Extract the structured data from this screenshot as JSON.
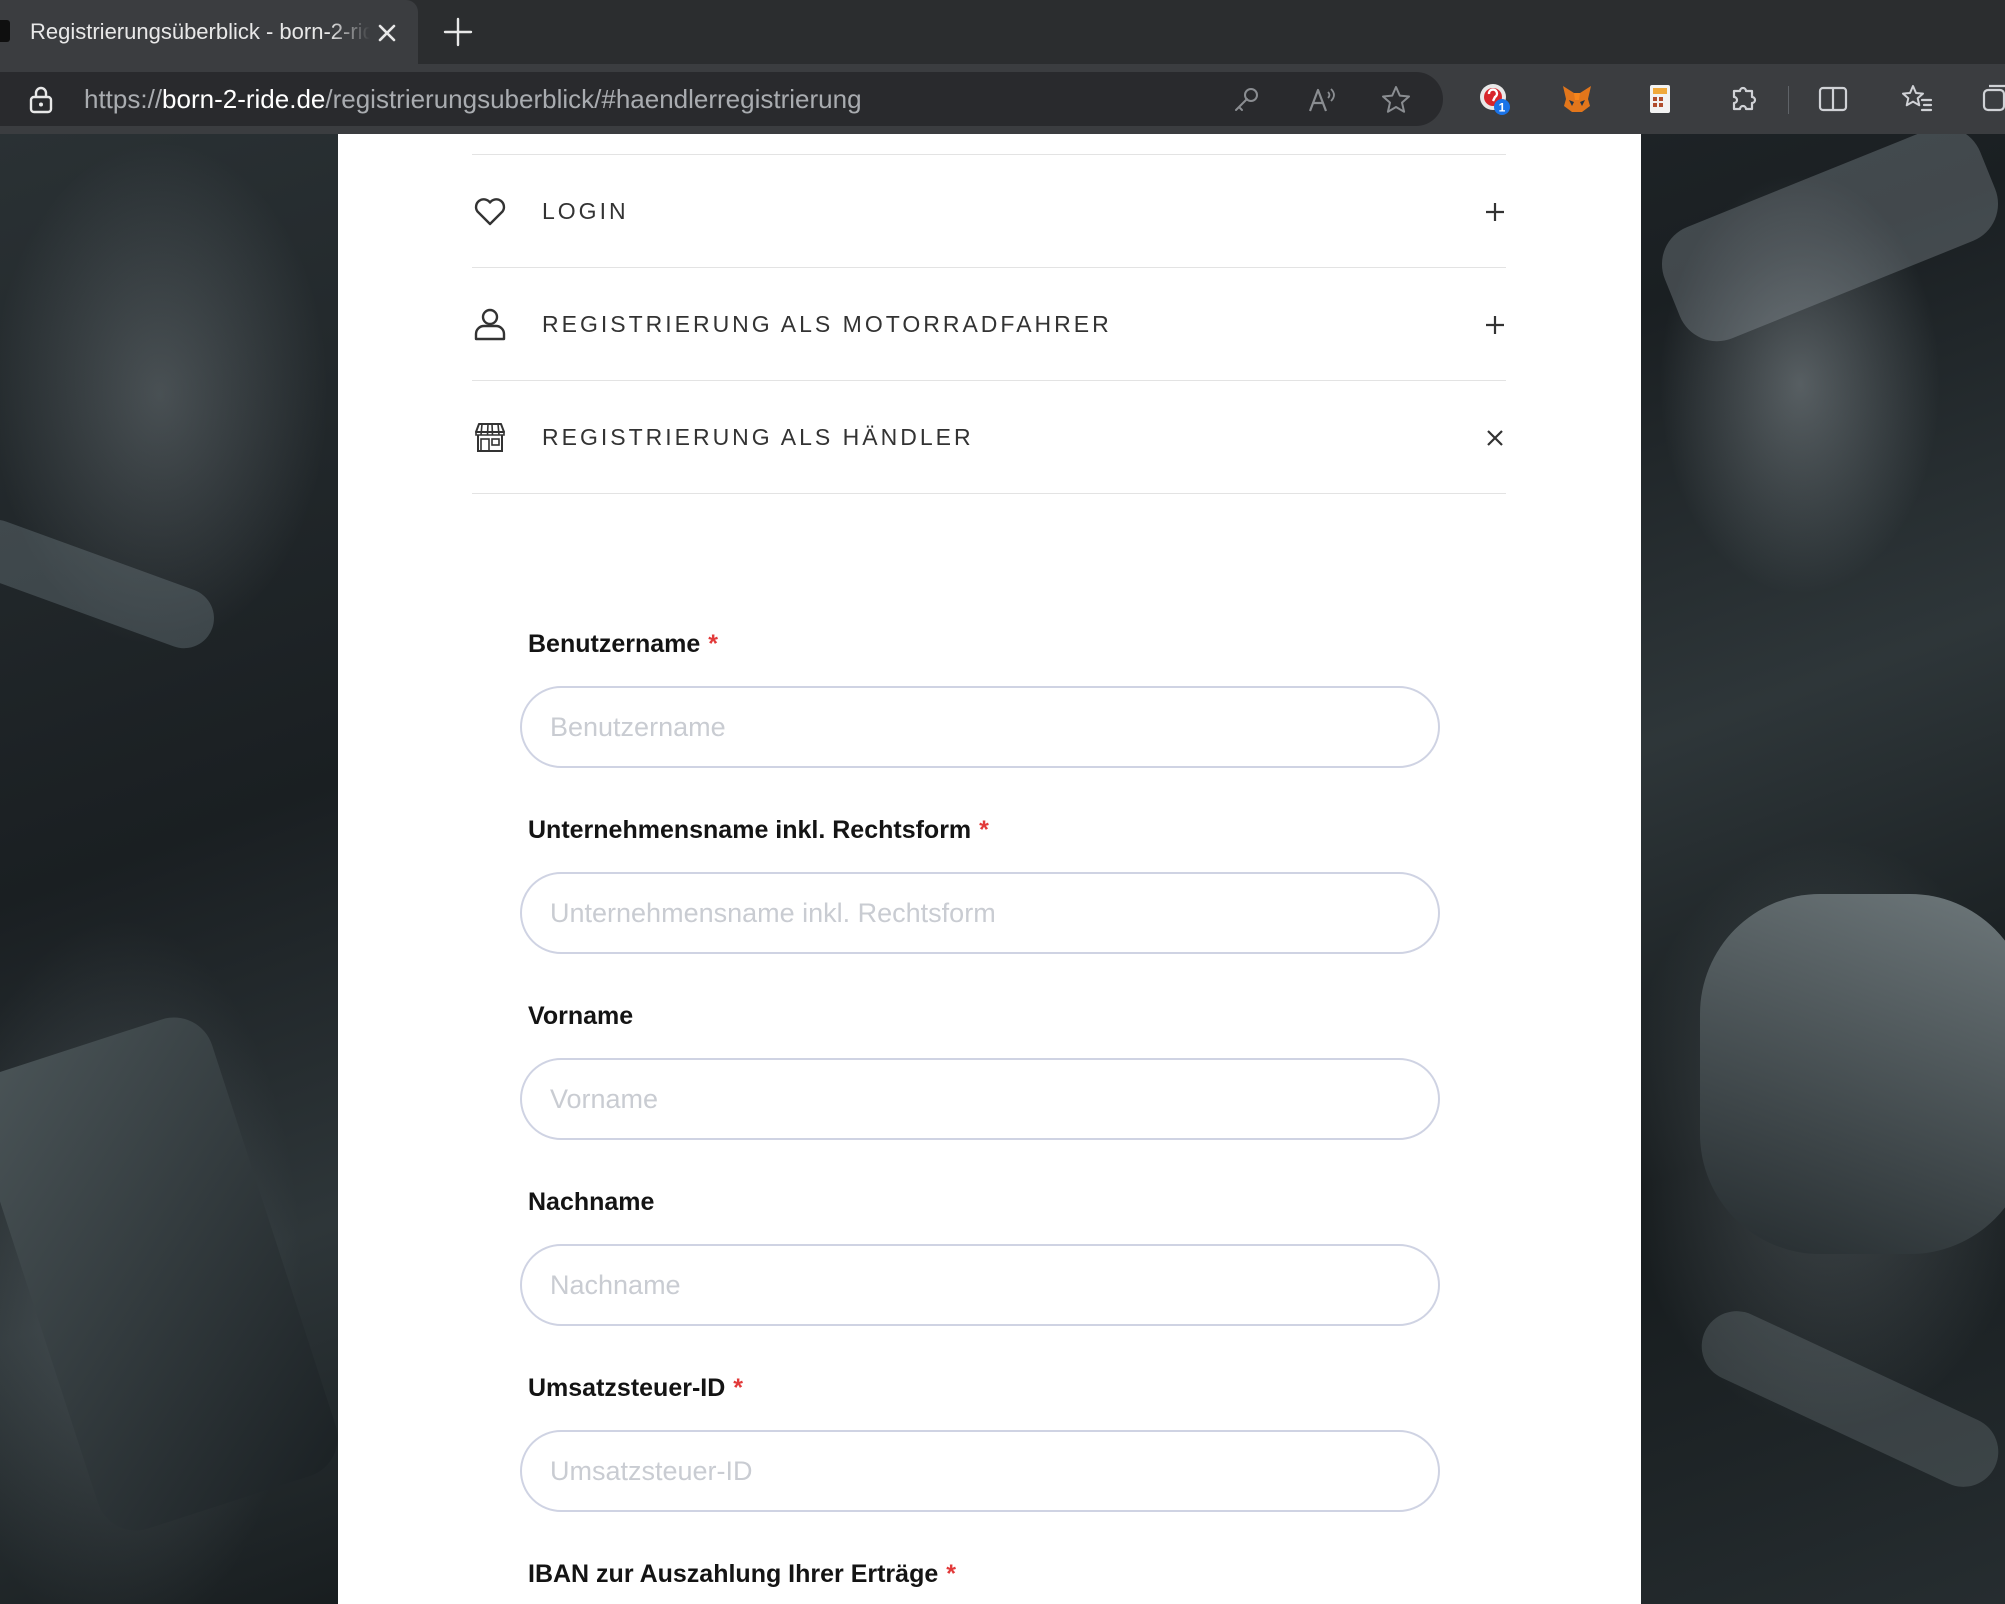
{
  "browser": {
    "tab_title": "Registrierungsüberblick - born-2-ride",
    "url_scheme": "https://",
    "url_host": "born-2-ride.de",
    "url_path": "/registrierungsuberblick/#haendlerregistrierung",
    "extension_badge": "1",
    "icons": [
      "lock-icon",
      "key-icon",
      "read-aloud-icon",
      "favorite-star-icon",
      "extension-red-icon",
      "metamask-fox-icon",
      "calculator-icon",
      "puzzle-icon",
      "split-screen-icon",
      "favorites-icon",
      "collections-icon"
    ]
  },
  "accordion": {
    "items": [
      {
        "label": "Login",
        "icon": "heart-icon",
        "toggle": "plus-icon"
      },
      {
        "label": "Registrierung als Motorradfahrer",
        "icon": "user-icon",
        "toggle": "plus-icon"
      },
      {
        "label": "Registrierung als Händler",
        "icon": "store-icon",
        "toggle": "close-icon"
      }
    ]
  },
  "form": {
    "required_mark": "*",
    "fields": [
      {
        "label": "Benutzername",
        "placeholder": "Benutzername",
        "required": true
      },
      {
        "label": "Unternehmensname inkl. Rechtsform",
        "placeholder": "Unternehmensname inkl. Rechtsform",
        "required": true
      },
      {
        "label": "Vorname",
        "placeholder": "Vorname",
        "required": false
      },
      {
        "label": "Nachname",
        "placeholder": "Nachname",
        "required": false
      },
      {
        "label": "Umsatzsteuer-ID",
        "placeholder": "Umsatzsteuer-ID",
        "required": true
      },
      {
        "label": "IBAN zur Auszahlung Ihrer Erträge",
        "required": true
      }
    ]
  },
  "colors": {
    "required": "#e23a3a",
    "input_border": "#cfd3e3",
    "placeholder": "#c9ccd2",
    "chrome_dark": "#2b2d2f",
    "chrome_tab": "#3b3d40"
  }
}
